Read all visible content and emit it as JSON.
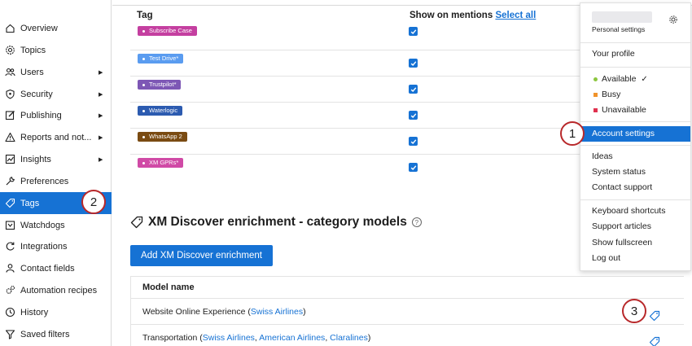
{
  "sidebar": {
    "items": [
      {
        "label": "Overview",
        "icon": "home-icon",
        "arrow": false,
        "active": false
      },
      {
        "label": "Topics",
        "icon": "topics-icon",
        "arrow": false,
        "active": false
      },
      {
        "label": "Users",
        "icon": "users-icon",
        "arrow": true,
        "active": false
      },
      {
        "label": "Security",
        "icon": "shield-icon",
        "arrow": true,
        "active": false
      },
      {
        "label": "Publishing",
        "icon": "edit-icon",
        "arrow": true,
        "active": false
      },
      {
        "label": "Reports and not...",
        "icon": "warning-icon",
        "arrow": true,
        "active": false
      },
      {
        "label": "Insights",
        "icon": "chart-icon",
        "arrow": true,
        "active": false
      },
      {
        "label": "Preferences",
        "icon": "wrench-icon",
        "arrow": false,
        "active": false
      },
      {
        "label": "Tags",
        "icon": "tag-icon",
        "arrow": false,
        "active": true
      },
      {
        "label": "Watchdogs",
        "icon": "watchdog-icon",
        "arrow": false,
        "active": false
      },
      {
        "label": "Integrations",
        "icon": "refresh-icon",
        "arrow": false,
        "active": false
      },
      {
        "label": "Contact fields",
        "icon": "person-icon",
        "arrow": false,
        "active": false
      },
      {
        "label": "Automation recipes",
        "icon": "gears-icon",
        "arrow": false,
        "active": false
      },
      {
        "label": "History",
        "icon": "clock-icon",
        "arrow": false,
        "active": false
      },
      {
        "label": "Saved filters",
        "icon": "filter-icon",
        "arrow": false,
        "active": false
      }
    ]
  },
  "tag_table": {
    "col_tag": "Tag",
    "col_show": "Show on mentions",
    "select_all": "Select all",
    "rows": [
      {
        "tag": "Subscribe Case",
        "color": "#c43fa0",
        "checked": true
      },
      {
        "tag": "Test Drive*",
        "color": "#5a9cf0",
        "checked": true
      },
      {
        "tag": "Trustpilot*",
        "color": "#7d57b5",
        "checked": true
      },
      {
        "tag": "Waterlogic",
        "color": "#2c5bb0",
        "checked": true
      },
      {
        "tag": "WhatsApp 2",
        "color": "#7a4b12",
        "checked": true
      },
      {
        "tag": "XM GPRs*",
        "color": "#d04aa6",
        "checked": true
      }
    ]
  },
  "enrichment": {
    "title": "XM Discover enrichment - category models",
    "help": "?",
    "add_button": "Add XM Discover enrichment",
    "col_model": "Model name",
    "models": [
      {
        "name": "Website Online Experience",
        "links": [
          "Swiss Airlines"
        ]
      },
      {
        "name": "Transportation",
        "links": [
          "Swiss Airlines",
          "American Airlines",
          "Claralines"
        ]
      }
    ]
  },
  "user_menu": {
    "personal_settings": "Personal settings",
    "your_profile": "Your profile",
    "statuses": [
      {
        "label": "Available",
        "color": "#8cc63f",
        "checked": true
      },
      {
        "label": "Busy",
        "color": "#f0932b",
        "checked": false
      },
      {
        "label": "Unavailable",
        "color": "#e0304e",
        "checked": false
      }
    ],
    "account_settings": "Account settings",
    "items_1": [
      "Ideas",
      "System status",
      "Contact support"
    ],
    "items_2": [
      "Keyboard shortcuts",
      "Support articles",
      "Show fullscreen",
      "Log out"
    ]
  },
  "callouts": [
    "1",
    "2",
    "3"
  ],
  "colors": {
    "accent": "#1672d4",
    "callout_border": "#b8282a"
  }
}
